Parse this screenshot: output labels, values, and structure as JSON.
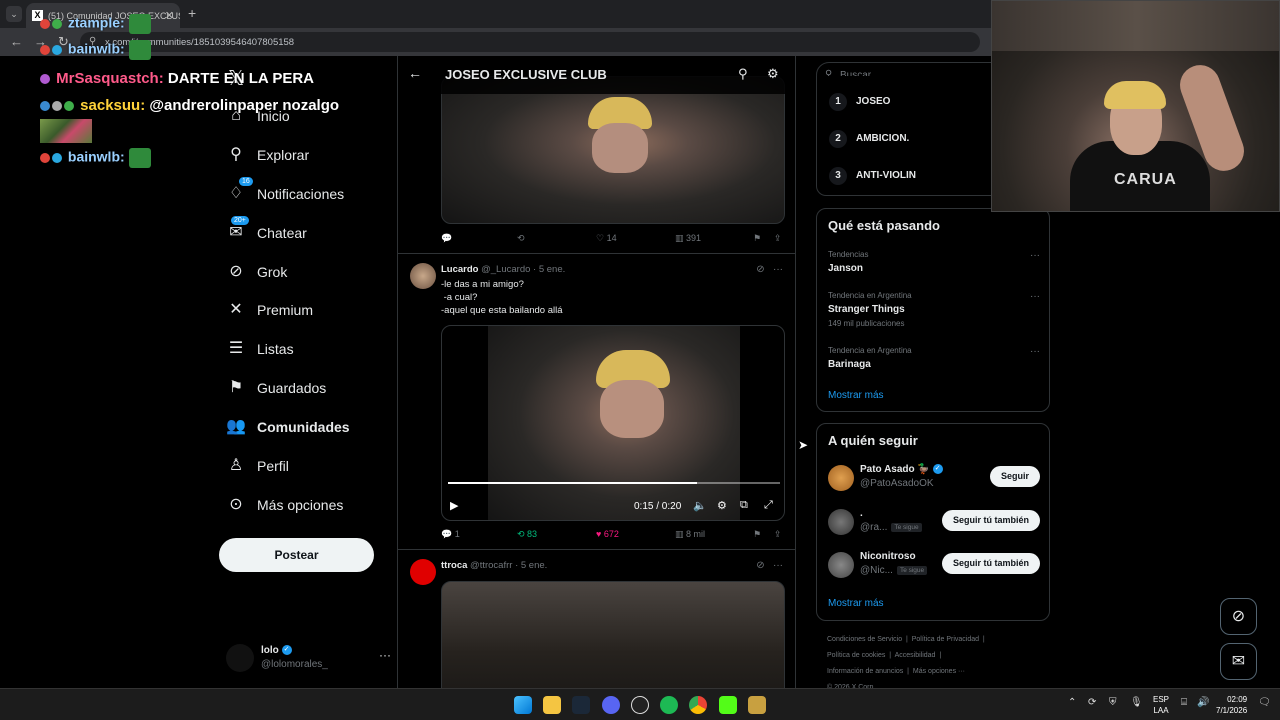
{
  "browser": {
    "tab_title": "(51) Comunidad JOSEO EXCLUS",
    "url": "x.com/i/communities/1851039546407805158"
  },
  "chat": [
    {
      "user": "ztample:",
      "msg": ""
    },
    {
      "user": "bainwlb:",
      "msg": ""
    },
    {
      "user": "MrSasquastch:",
      "msg": "DARTE EN LA PERA"
    },
    {
      "user": "sacksuu:",
      "msg": "@andrerolinpaper nozalgo"
    },
    {
      "user": "bainwlb:",
      "msg": ""
    }
  ],
  "sidebar": {
    "items": [
      {
        "label": "Inicio",
        "icon": "home-icon"
      },
      {
        "label": "Explorar",
        "icon": "search-icon"
      },
      {
        "label": "Notificaciones",
        "icon": "bell-icon",
        "badge": "16"
      },
      {
        "label": "Chatear",
        "icon": "mail-icon",
        "badge": "20+"
      },
      {
        "label": "Grok",
        "icon": "grok-icon"
      },
      {
        "label": "Premium",
        "icon": "x-icon"
      },
      {
        "label": "Listas",
        "icon": "list-icon"
      },
      {
        "label": "Guardados",
        "icon": "bookmark-icon"
      },
      {
        "label": "Comunidades",
        "icon": "people-icon"
      },
      {
        "label": "Perfil",
        "icon": "person-icon"
      },
      {
        "label": "Más opciones",
        "icon": "more-circle-icon"
      }
    ],
    "post_button": "Postear",
    "account": {
      "name": "lolo",
      "handle": "@lolomorales_"
    }
  },
  "main": {
    "header_title": "JOSEO EXCLUSIVE CLUB",
    "tweet1_actions": {
      "replies": "",
      "reposts": "",
      "likes": "14",
      "views": "391"
    },
    "tweet2": {
      "name": "Lucardo",
      "handle": "@_Lucardo",
      "time": "5 ene.",
      "text": "-le das a mi amigo?\n -a cual?\n-aquel que esta bailando allá",
      "video_time": "0:15 / 0:20",
      "video_progress": 0.75,
      "actions": {
        "replies": "1",
        "reposts": "83",
        "likes": "672",
        "views": "8 mil"
      }
    },
    "tweet3": {
      "name": "ttroca",
      "handle": "@ttrocafrr",
      "time": "5 ene."
    }
  },
  "right": {
    "search_placeholder": "Buscar",
    "ranking": [
      {
        "num": "1",
        "label": "JOSEO"
      },
      {
        "num": "2",
        "label": "AMBICION."
      },
      {
        "num": "3",
        "label": "ANTI-VIOLIN"
      }
    ],
    "trends_title": "Qué está pasando",
    "trends": [
      {
        "category": "Tendencias",
        "title": "Janson",
        "count": ""
      },
      {
        "category": "Tendencia en Argentina",
        "title": "Stranger Things",
        "count": "149 mil publicaciones"
      },
      {
        "category": "Tendencia en Argentina",
        "title": "Barinaga",
        "count": ""
      }
    ],
    "show_more": "Mostrar más",
    "follow_title": "A quién seguir",
    "follow": [
      {
        "name": "Pato Asado 🦆",
        "handle": "@PatoAsadoOK",
        "button": "Seguir",
        "tag": ""
      },
      {
        "name": ".",
        "handle": "@ra...",
        "button": "Seguir tú también",
        "tag": "Te sigue"
      },
      {
        "name": "Niconitroso",
        "handle": "@Nic...",
        "button": "Seguir tú también",
        "tag": "Te sigue"
      }
    ],
    "follow_show_more": "Mostrar más",
    "footer": [
      "Condiciones de Servicio",
      "Política de Privacidad",
      "Política de cookies",
      "Accesibilidad",
      "Información de anuncios",
      "Más opciones ···",
      "© 2026 X Corp."
    ]
  },
  "webcam": {
    "shirt_text": "CARUA"
  },
  "taskbar": {
    "lang_top": "ESP",
    "lang_bottom": "LAA",
    "time": "02:09",
    "date": "7/1/2026"
  },
  "colors": {
    "accent": "#1d9bf0",
    "border": "#2f3336",
    "muted": "#71767b",
    "like": "#f91880",
    "repost": "#00ba7c"
  }
}
